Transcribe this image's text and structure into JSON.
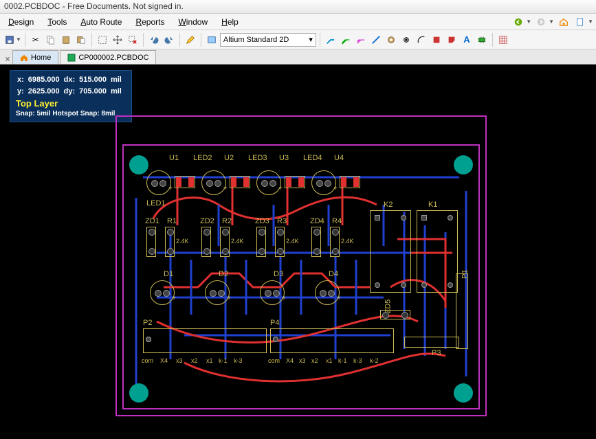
{
  "title": "0002.PCBDOC - Free Documents. Not signed in.",
  "menu": {
    "design": "Design",
    "tools": "Tools",
    "autoroute": "Auto Route",
    "reports": "Reports",
    "window": "Window",
    "help": "Help"
  },
  "toolbar": {
    "view_mode": "Altium Standard 2D"
  },
  "tabs": {
    "home": "Home",
    "doc": "CP000002.PCBDOC"
  },
  "hud": {
    "x_label": "x:",
    "x": "6985.000",
    "dx_label": "dx:",
    "dx": "515.000",
    "unit1": "mil",
    "y_label": "y:",
    "y": "2625.000",
    "dy_label": "dy:",
    "dy": "705.000",
    "unit2": "mil",
    "layer": "Top Layer",
    "snap": "Snap: 5mil Hotspot Snap: 8mil"
  },
  "designators": {
    "u1": "U1",
    "u2": "U2",
    "u3": "U3",
    "u4": "U4",
    "led1": "LED1",
    "led2": "LED2",
    "led3": "LED3",
    "led4": "LED4",
    "zd1": "ZD1",
    "zd2": "ZD2",
    "zd3": "ZD3",
    "zd4": "ZD4",
    "zd5": "ZD5",
    "r1": "R1",
    "r2": "R2",
    "r3": "R3",
    "r4": "R4",
    "r1v": "2.4K",
    "r2v": "2.4K",
    "r3v": "2.4K",
    "r4v": "2.4K",
    "d1": "D1",
    "d2": "D2",
    "d3": "D3",
    "d4": "D4",
    "k1": "K1",
    "k2": "K2",
    "p1": "P1",
    "p2": "P2",
    "p3": "P3",
    "p4": "P4",
    "com1": "com",
    "com2": "com",
    "x1": "x1",
    "x2": "x2",
    "x3": "x3",
    "x4": "X4",
    "x1b": "x1",
    "x2b": "x2",
    "x3b": "x3",
    "x4b": "X4",
    "k_1": "k-1",
    "k_2": "k-2",
    "k_3": "k-3",
    "k_1b": "k-1",
    "k_3b": "k-3"
  }
}
